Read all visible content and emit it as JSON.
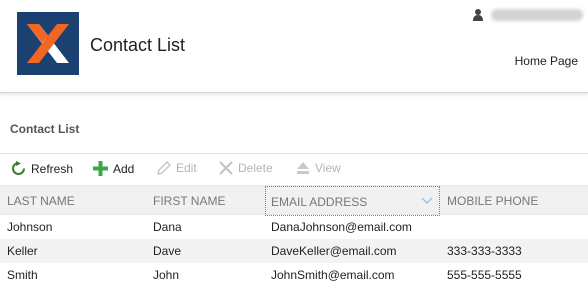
{
  "header": {
    "title": "Contact List",
    "user_name": "",
    "home_link": "Home Page"
  },
  "section": {
    "title": "Contact List"
  },
  "toolbar": {
    "refresh": "Refresh",
    "add": "Add",
    "edit": "Edit",
    "delete": "Delete",
    "view": "View"
  },
  "grid": {
    "columns": [
      "LAST NAME",
      "FIRST NAME",
      "EMAIL ADDRESS",
      "MOBILE PHONE"
    ],
    "rows": [
      [
        "Johnson",
        "Dana",
        "DanaJohnson@email.com",
        ""
      ],
      [
        "Keller",
        "Dave",
        "DaveKeller@email.com",
        "333-333-3333"
      ],
      [
        "Smith",
        "John",
        "JohnSmith@email.com",
        "555-555-5555"
      ]
    ]
  },
  "colors": {
    "logo_bg": "#1b4170",
    "logo_orange": "#f26522",
    "add_green": "#3aa845",
    "refresh_green": "#3d7a2a",
    "focus_border": "#3b8fe0"
  }
}
